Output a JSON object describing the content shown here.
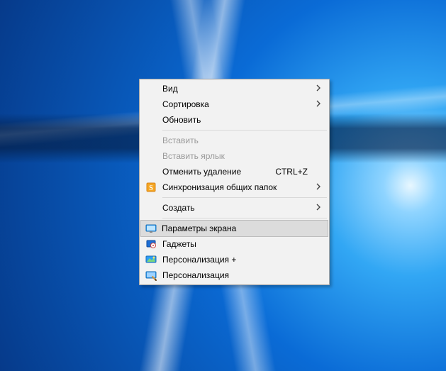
{
  "context_menu": {
    "items": [
      {
        "id": "view",
        "label": "Вид",
        "submenu": true
      },
      {
        "id": "sort",
        "label": "Сортировка",
        "submenu": true
      },
      {
        "id": "refresh",
        "label": "Обновить"
      },
      {
        "sep": true
      },
      {
        "id": "paste",
        "label": "Вставить",
        "disabled": true
      },
      {
        "id": "paste-shortcut",
        "label": "Вставить ярлык",
        "disabled": true
      },
      {
        "id": "undo-delete",
        "label": "Отменить удаление",
        "shortcut": "CTRL+Z"
      },
      {
        "id": "sync-shared",
        "label": "Синхронизация общих папок",
        "submenu": true,
        "icon": "sync-orange"
      },
      {
        "sep": true
      },
      {
        "id": "new",
        "label": "Создать",
        "submenu": true
      },
      {
        "sep": true
      },
      {
        "id": "display",
        "label": "Параметры экрана",
        "icon": "monitor",
        "selected": true
      },
      {
        "id": "gadgets",
        "label": "Гаджеты",
        "icon": "gadgets"
      },
      {
        "id": "personalize2",
        "label": "Персонализация +",
        "icon": "personalize-plus"
      },
      {
        "id": "personalize",
        "label": "Персонализация",
        "icon": "personalize"
      }
    ]
  }
}
